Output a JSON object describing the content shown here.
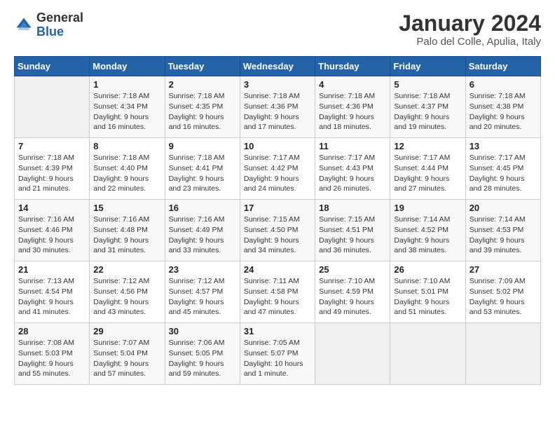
{
  "logo": {
    "general": "General",
    "blue": "Blue"
  },
  "title": "January 2024",
  "location": "Palo del Colle, Apulia, Italy",
  "days_header": [
    "Sunday",
    "Monday",
    "Tuesday",
    "Wednesday",
    "Thursday",
    "Friday",
    "Saturday"
  ],
  "weeks": [
    [
      {
        "day": "",
        "info": ""
      },
      {
        "day": "1",
        "info": "Sunrise: 7:18 AM\nSunset: 4:34 PM\nDaylight: 9 hours\nand 16 minutes."
      },
      {
        "day": "2",
        "info": "Sunrise: 7:18 AM\nSunset: 4:35 PM\nDaylight: 9 hours\nand 16 minutes."
      },
      {
        "day": "3",
        "info": "Sunrise: 7:18 AM\nSunset: 4:36 PM\nDaylight: 9 hours\nand 17 minutes."
      },
      {
        "day": "4",
        "info": "Sunrise: 7:18 AM\nSunset: 4:36 PM\nDaylight: 9 hours\nand 18 minutes."
      },
      {
        "day": "5",
        "info": "Sunrise: 7:18 AM\nSunset: 4:37 PM\nDaylight: 9 hours\nand 19 minutes."
      },
      {
        "day": "6",
        "info": "Sunrise: 7:18 AM\nSunset: 4:38 PM\nDaylight: 9 hours\nand 20 minutes."
      }
    ],
    [
      {
        "day": "7",
        "info": "Sunrise: 7:18 AM\nSunset: 4:39 PM\nDaylight: 9 hours\nand 21 minutes."
      },
      {
        "day": "8",
        "info": "Sunrise: 7:18 AM\nSunset: 4:40 PM\nDaylight: 9 hours\nand 22 minutes."
      },
      {
        "day": "9",
        "info": "Sunrise: 7:18 AM\nSunset: 4:41 PM\nDaylight: 9 hours\nand 23 minutes."
      },
      {
        "day": "10",
        "info": "Sunrise: 7:17 AM\nSunset: 4:42 PM\nDaylight: 9 hours\nand 24 minutes."
      },
      {
        "day": "11",
        "info": "Sunrise: 7:17 AM\nSunset: 4:43 PM\nDaylight: 9 hours\nand 26 minutes."
      },
      {
        "day": "12",
        "info": "Sunrise: 7:17 AM\nSunset: 4:44 PM\nDaylight: 9 hours\nand 27 minutes."
      },
      {
        "day": "13",
        "info": "Sunrise: 7:17 AM\nSunset: 4:45 PM\nDaylight: 9 hours\nand 28 minutes."
      }
    ],
    [
      {
        "day": "14",
        "info": "Sunrise: 7:16 AM\nSunset: 4:46 PM\nDaylight: 9 hours\nand 30 minutes."
      },
      {
        "day": "15",
        "info": "Sunrise: 7:16 AM\nSunset: 4:48 PM\nDaylight: 9 hours\nand 31 minutes."
      },
      {
        "day": "16",
        "info": "Sunrise: 7:16 AM\nSunset: 4:49 PM\nDaylight: 9 hours\nand 33 minutes."
      },
      {
        "day": "17",
        "info": "Sunrise: 7:15 AM\nSunset: 4:50 PM\nDaylight: 9 hours\nand 34 minutes."
      },
      {
        "day": "18",
        "info": "Sunrise: 7:15 AM\nSunset: 4:51 PM\nDaylight: 9 hours\nand 36 minutes."
      },
      {
        "day": "19",
        "info": "Sunrise: 7:14 AM\nSunset: 4:52 PM\nDaylight: 9 hours\nand 38 minutes."
      },
      {
        "day": "20",
        "info": "Sunrise: 7:14 AM\nSunset: 4:53 PM\nDaylight: 9 hours\nand 39 minutes."
      }
    ],
    [
      {
        "day": "21",
        "info": "Sunrise: 7:13 AM\nSunset: 4:54 PM\nDaylight: 9 hours\nand 41 minutes."
      },
      {
        "day": "22",
        "info": "Sunrise: 7:12 AM\nSunset: 4:56 PM\nDaylight: 9 hours\nand 43 minutes."
      },
      {
        "day": "23",
        "info": "Sunrise: 7:12 AM\nSunset: 4:57 PM\nDaylight: 9 hours\nand 45 minutes."
      },
      {
        "day": "24",
        "info": "Sunrise: 7:11 AM\nSunset: 4:58 PM\nDaylight: 9 hours\nand 47 minutes."
      },
      {
        "day": "25",
        "info": "Sunrise: 7:10 AM\nSunset: 4:59 PM\nDaylight: 9 hours\nand 49 minutes."
      },
      {
        "day": "26",
        "info": "Sunrise: 7:10 AM\nSunset: 5:01 PM\nDaylight: 9 hours\nand 51 minutes."
      },
      {
        "day": "27",
        "info": "Sunrise: 7:09 AM\nSunset: 5:02 PM\nDaylight: 9 hours\nand 53 minutes."
      }
    ],
    [
      {
        "day": "28",
        "info": "Sunrise: 7:08 AM\nSunset: 5:03 PM\nDaylight: 9 hours\nand 55 minutes."
      },
      {
        "day": "29",
        "info": "Sunrise: 7:07 AM\nSunset: 5:04 PM\nDaylight: 9 hours\nand 57 minutes."
      },
      {
        "day": "30",
        "info": "Sunrise: 7:06 AM\nSunset: 5:05 PM\nDaylight: 9 hours\nand 59 minutes."
      },
      {
        "day": "31",
        "info": "Sunrise: 7:05 AM\nSunset: 5:07 PM\nDaylight: 10 hours\nand 1 minute."
      },
      {
        "day": "",
        "info": ""
      },
      {
        "day": "",
        "info": ""
      },
      {
        "day": "",
        "info": ""
      }
    ]
  ]
}
